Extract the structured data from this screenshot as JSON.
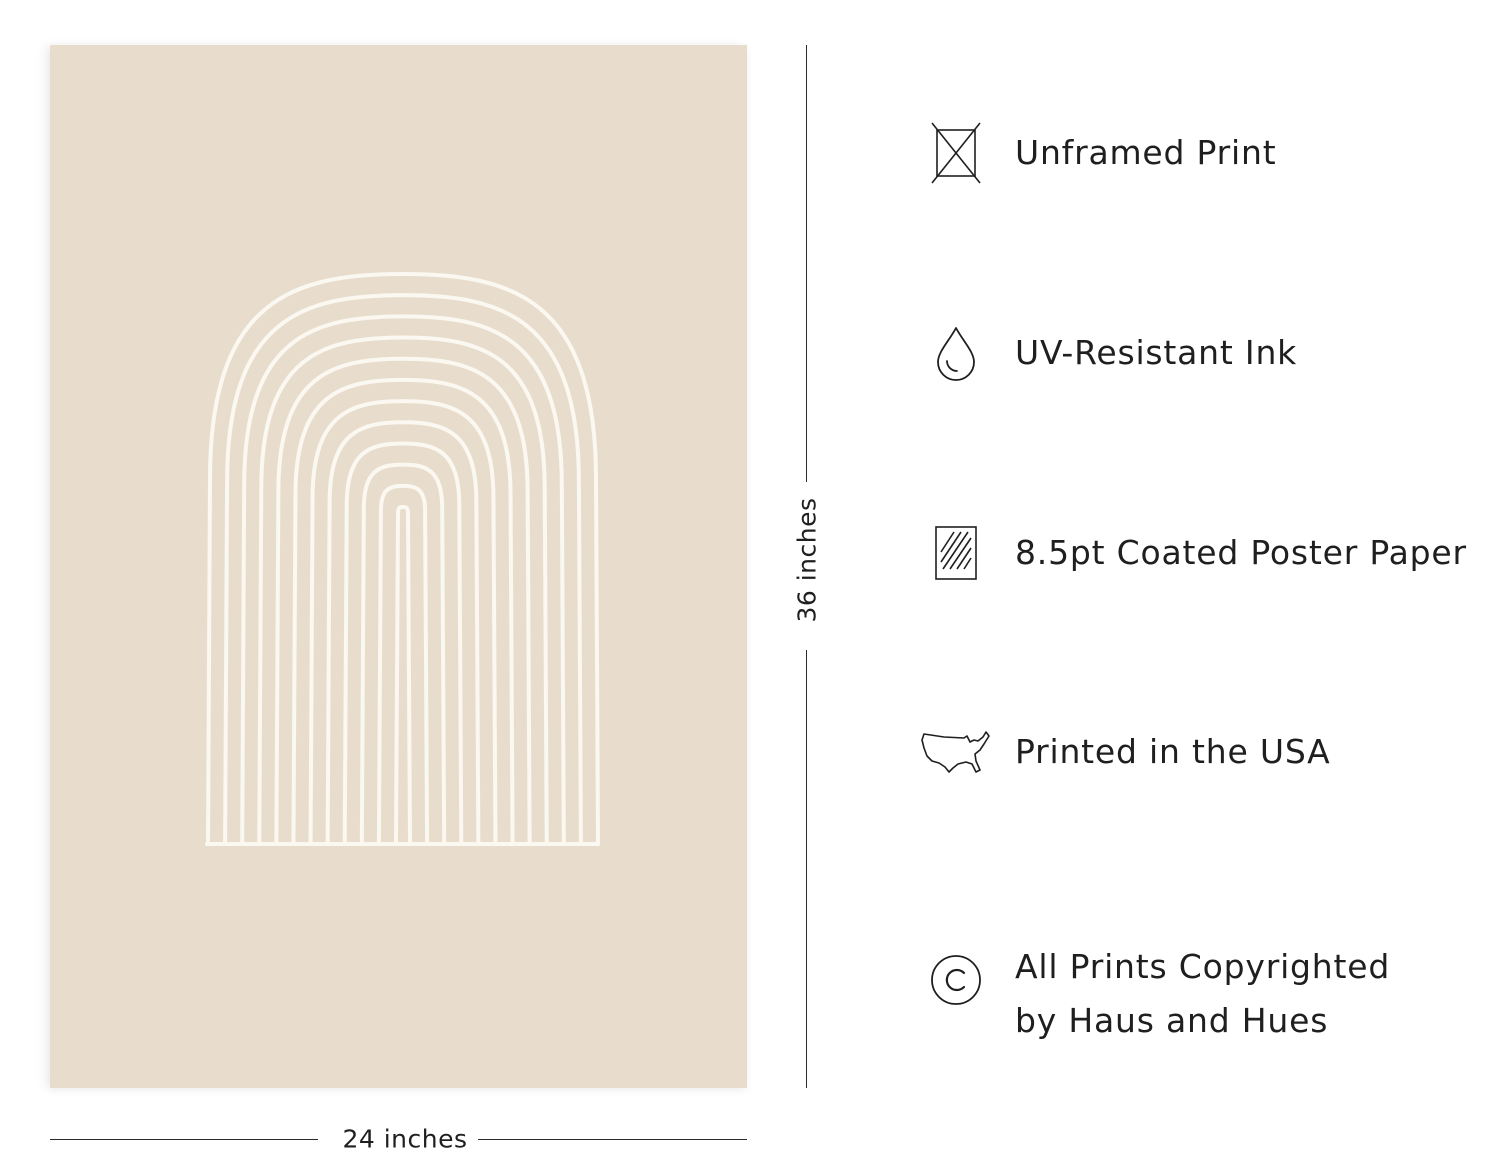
{
  "poster": {
    "background_color": "#e8ddcc",
    "line_color": "#fbf8f1"
  },
  "dimensions": {
    "height_label": "36 inches",
    "width_label": "24 inches"
  },
  "features": [
    {
      "icon": "unframed-icon",
      "label": "Unframed Print"
    },
    {
      "icon": "ink-drop-icon",
      "label": "UV-Resistant Ink"
    },
    {
      "icon": "paper-icon",
      "label": "8.5pt Coated Poster Paper"
    },
    {
      "icon": "usa-map-icon",
      "label": "Printed in the USA"
    },
    {
      "icon": "copyright-icon",
      "label": "All Prints Copyrighted\nby Haus and Hues"
    }
  ]
}
